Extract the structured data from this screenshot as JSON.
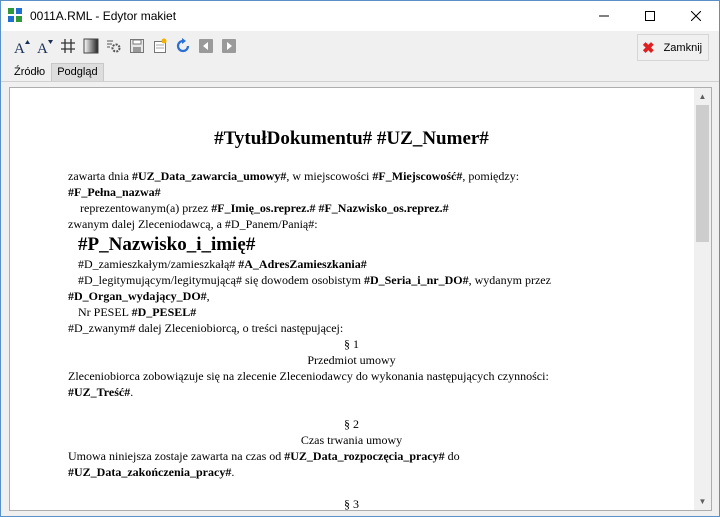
{
  "window": {
    "title": "0011A.RML - Edytor makiet"
  },
  "toolbar": {
    "buttons": [
      {
        "icon": "font-increase-icon"
      },
      {
        "icon": "font-decrease-icon"
      },
      {
        "icon": "grid-icon"
      },
      {
        "icon": "gradient-icon"
      },
      {
        "icon": "settings-icon"
      },
      {
        "icon": "save-icon"
      },
      {
        "icon": "new-template-icon"
      },
      {
        "icon": "refresh-icon"
      },
      {
        "icon": "prev-icon"
      },
      {
        "icon": "next-icon"
      }
    ],
    "close_label": "Zamknij"
  },
  "tabs": [
    {
      "label": "Źródło"
    },
    {
      "label": "Podgląd"
    }
  ],
  "document": {
    "title": "#TytułDokumentu# #UZ_Numer#",
    "l1a": "zawarta dnia ",
    "l1b": "#UZ_Data_zawarcia_umowy#",
    "l1c": ", w miejscowości ",
    "l1d": "#F_Miejscowość#",
    "l1e": ", pomiędzy:",
    "l2": "#F_Pełna_nazwa#",
    "l3a": "reprezentowanym(a) przez ",
    "l3b": "#F_Imię_os.reprez.# #F_Nazwisko_os.reprez.#",
    "l4": "zwanym dalej Zleceniodawcą, a #D_Panem/Panią#:",
    "l5": "#P_Nazwisko_i_imię#",
    "l6a": "#D_zamieszkałym/zamieszkałą# ",
    "l6b": "#A_AdresZamieszkania#",
    "l7a": "#D_legitymującym/legitymującą# się dowodem osobistym ",
    "l7b": "#D_Seria_i_nr_DO#",
    "l7c": ", wydanym przez",
    "l8a": "#D_Organ_wydający_DO#",
    "l8b": ",",
    "l9a": "Nr PESEL ",
    "l9b": "#D_PESEL#",
    "l10": "#D_zwanym# dalej Zleceniobiorcą, o treści następującej:",
    "s1": "§ 1",
    "s1_title": "Przedmiot umowy",
    "s1_text": "Zleceniobiorca zobowiązuje się na zlecenie Zleceniodawcy do wykonania następujących czynności:",
    "s1_field_a": "#UZ_Treść#",
    "s1_field_b": ".",
    "s2": "§ 2",
    "s2_title": "Czas trwania umowy",
    "s2_text_a": "Umowa niniejsza zostaje zawarta na czas od ",
    "s2_text_b": "#UZ_Data_rozpoczęcia_pracy#",
    "s2_text_c": " do",
    "s2_field_a": "#UZ_Data_zakończenia_pracy#",
    "s2_field_b": ".",
    "s3": "§ 3"
  }
}
